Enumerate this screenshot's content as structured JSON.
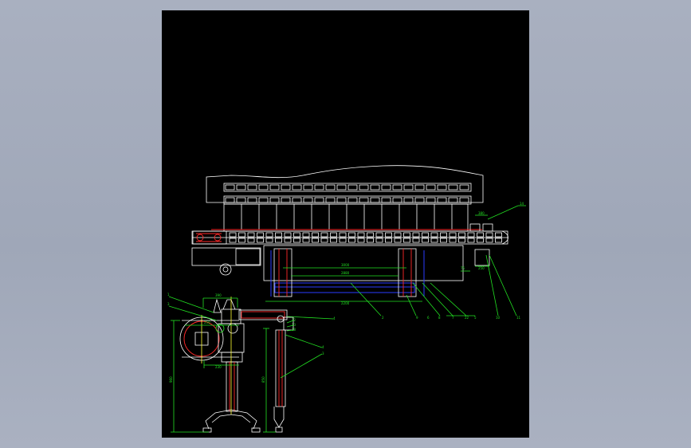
{
  "colors": {
    "background": "#a3aabb",
    "sheet": "#000000",
    "outline": "#ffffff",
    "dimension": "#22e022",
    "hidden_line": "#2a3cff",
    "section": "#ff2a2a",
    "centerline": "#ffff33"
  },
  "elevation_view": {
    "dimensions": [
      "3000",
      "2880",
      "2200",
      "380",
      "75",
      "250"
    ],
    "balloons": [
      "14",
      "2",
      "9",
      "8",
      "7",
      "22",
      "6",
      "5",
      "10",
      "11"
    ]
  },
  "side_view": {
    "dimensions": [
      "390",
      "250",
      "230",
      "960",
      "850"
    ],
    "balloons": [
      "1",
      "3",
      "4",
      "12",
      "13",
      "18",
      "4",
      "3"
    ]
  }
}
